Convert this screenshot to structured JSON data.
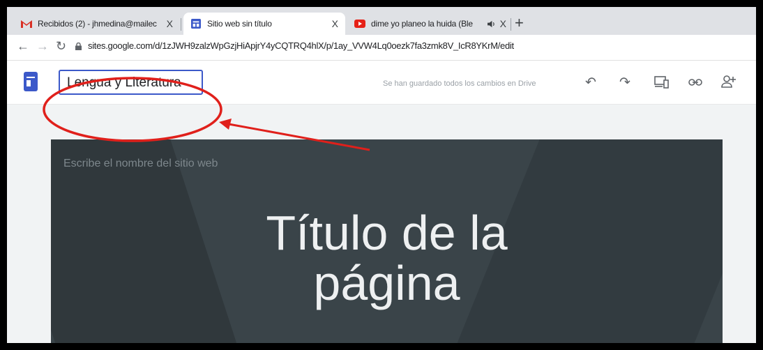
{
  "browser": {
    "tabs": [
      {
        "title": "Recibidos (2) - jhmedina@mailec",
        "close": "X",
        "favicon": "gmail-icon"
      },
      {
        "title": "Sitio web sin título",
        "close": "X",
        "favicon": "google-sites-icon"
      },
      {
        "title": "dime yo planeo la huida (Ble",
        "close": "X",
        "favicon": "youtube-icon"
      }
    ],
    "new_tab": "+",
    "url": "sites.google.com/d/1zJWH9zalzWpGzjHiApjrY4yCQTRQ4hlX/p/1ay_VVW4Lq0oezk7fa3zmk8V_IcR8YKrM/edit"
  },
  "sites": {
    "site_name_value": "Lengua y Literatura",
    "save_status": "Se han guardado todos los cambios en Drive",
    "hero": {
      "site_name_placeholder": "Escribe el nombre del sitio web",
      "page_title_line1": "Título de la",
      "page_title_line2": "página"
    }
  },
  "colors": {
    "accent": "#3c59c9",
    "annotation": "#e0201b",
    "hero_bg": "#3a4449"
  }
}
